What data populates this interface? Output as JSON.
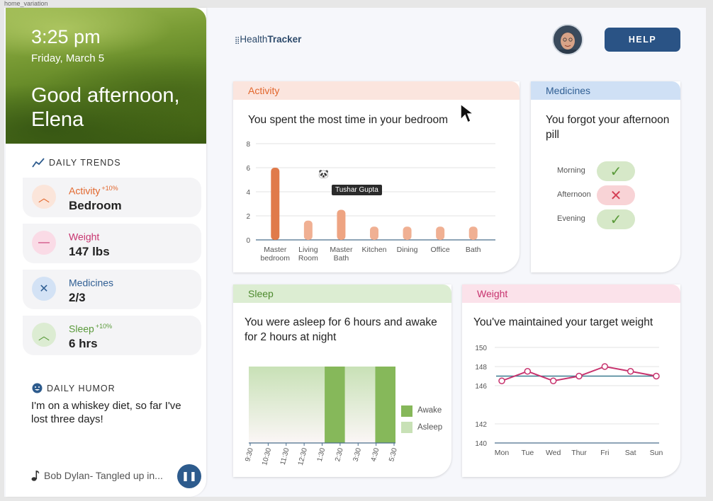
{
  "window_label": "home_variation",
  "sidebar": {
    "time": "3:25 pm",
    "date": "Friday, March 5",
    "greeting": "Good afternoon, Elena",
    "trends_heading": "DAILY TRENDS",
    "trends": [
      {
        "name": "Activity",
        "delta": "+10%",
        "value": "Bedroom",
        "color": "#e2672d",
        "bg": "#fbe5da",
        "icon": "chevron-up-icon",
        "glyph": "︿"
      },
      {
        "name": "Weight",
        "delta": "",
        "value": "147 lbs",
        "color": "#c7336e",
        "bg": "#fadbe6",
        "icon": "minus-icon",
        "glyph": "—"
      },
      {
        "name": "Medicines",
        "delta": "",
        "value": "2/3",
        "color": "#2f5e93",
        "bg": "#d3e2f5",
        "icon": "x-icon",
        "glyph": "✕"
      },
      {
        "name": "Sleep",
        "delta": "+10%",
        "value": "6 hrs",
        "color": "#5a9a3a",
        "bg": "#dcecd2",
        "icon": "chevron-up-icon",
        "glyph": "︿"
      }
    ],
    "humor_heading": "DAILY HUMOR",
    "humor_text": "I'm on a whiskey diet, so far I've lost three days!",
    "music_text": "Bob Dylan- Tangled up in...",
    "play_glyph": "❚❚"
  },
  "header": {
    "logo_prefix": "Health",
    "logo_suffix": "Tracker",
    "logo_icon_glyph": "⣿",
    "help_label": "HELP"
  },
  "activity": {
    "tab": "Activity",
    "tab_color": "#e2672d",
    "tab_bg": "#fbe5de",
    "headline": "You spent the most time in your bedroom",
    "tooltip": "Tushar Gupta",
    "puppy_glyph": "🐼"
  },
  "medicines": {
    "tab": "Medicines",
    "tab_color": "#2f5e93",
    "tab_bg": "#cfe0f5",
    "headline": "You forgot your afternoon pill",
    "doses": [
      {
        "label": "Morning",
        "taken": true,
        "glyph": "✓"
      },
      {
        "label": "Afternoon",
        "taken": false,
        "glyph": "✕"
      },
      {
        "label": "Evening",
        "taken": true,
        "glyph": "✓"
      }
    ]
  },
  "sleep": {
    "tab": "Sleep",
    "tab_color": "#4d8a2e",
    "tab_bg": "#dcedd2",
    "headline": "You were asleep for 6 hours and awake for 2 hours at night",
    "legend_awake": "Awake",
    "legend_asleep": "Asleep"
  },
  "weight": {
    "tab": "Weight",
    "tab_color": "#c7336e",
    "tab_bg": "#fbe2ea",
    "headline": "You've maintained your target weight"
  },
  "chart_data": [
    {
      "type": "bar",
      "categories": [
        "Master bedroom",
        "Living Room",
        "Master Bath",
        "Kitchen",
        "Dining",
        "Office",
        "Bath"
      ],
      "values": [
        6,
        1.6,
        2.5,
        1.1,
        1.1,
        1.1,
        1.1
      ],
      "yticks": [
        0,
        2,
        4,
        6,
        8
      ],
      "ylim": [
        0,
        8
      ],
      "colors": [
        "#e07a4a",
        "#f0b093",
        "#eea482",
        "#f0b093",
        "#f0b093",
        "#f0b093",
        "#f0b093"
      ]
    },
    {
      "type": "area",
      "categories": [
        "9:30",
        "10:30",
        "11:30",
        "12:30",
        "1:30",
        "2:30",
        "3:30",
        "4:30",
        "5:30"
      ],
      "series": [
        {
          "name": "Asleep",
          "intervals": [
            [
              0,
              3.75
            ],
            [
              4.75,
              6.25
            ]
          ],
          "color": "#c8e1b6"
        },
        {
          "name": "Awake",
          "intervals": [
            [
              3.75,
              4.75
            ],
            [
              6.25,
              7.25
            ]
          ],
          "color": "#86b85a"
        }
      ],
      "xlim": [
        0,
        7.25
      ]
    },
    {
      "type": "line",
      "categories": [
        "Mon",
        "Tue",
        "Wed",
        "Thur",
        "Fri",
        "Sat",
        "Sun"
      ],
      "series": [
        {
          "values": [
            146.5,
            147.5,
            146.5,
            147,
            148,
            147.5,
            147
          ],
          "color": "#c7336e"
        }
      ],
      "target": 147,
      "target_color": "#3b7a8f",
      "yticks": [
        140,
        142,
        146,
        148,
        150
      ],
      "ylim": [
        140,
        150
      ]
    }
  ]
}
